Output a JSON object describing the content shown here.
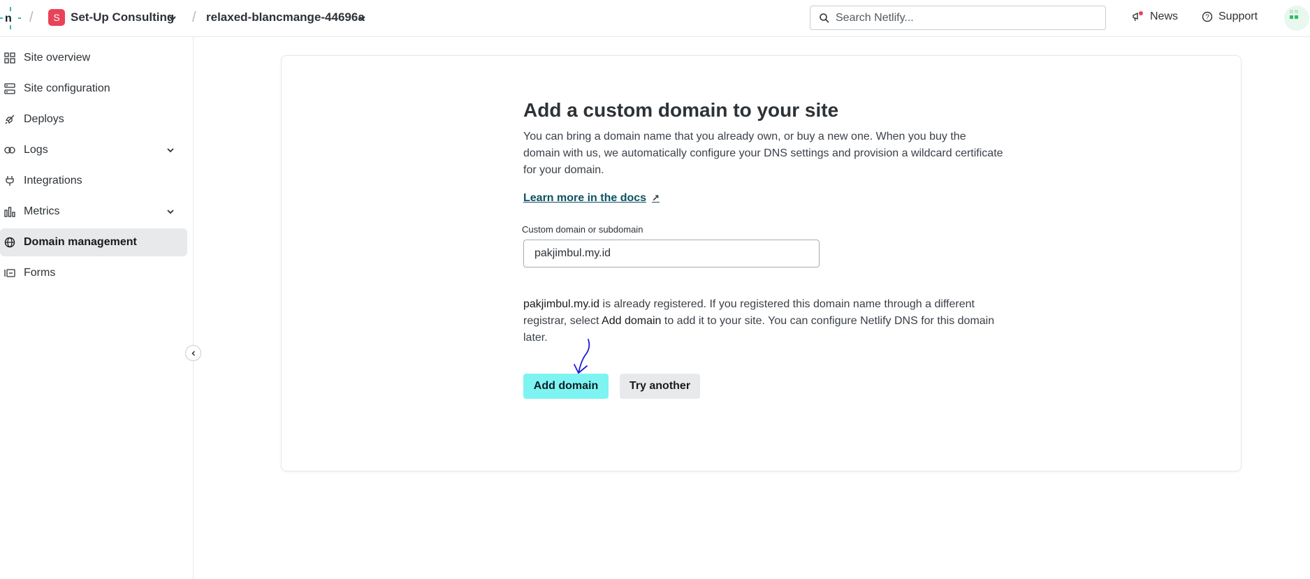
{
  "header": {
    "team_initial": "S",
    "team_name": "Set-Up Consulting",
    "site_name": "relaxed-blancmange-44696a",
    "search_placeholder": "Search Netlify...",
    "news_label": "News",
    "support_label": "Support",
    "separator": "/"
  },
  "sidebar": {
    "items": [
      {
        "label": "Site overview",
        "icon": "grid-icon"
      },
      {
        "label": "Site configuration",
        "icon": "settings-list-icon"
      },
      {
        "label": "Deploys",
        "icon": "rocket-icon"
      },
      {
        "label": "Logs",
        "icon": "logs-icon",
        "expandable": true
      },
      {
        "label": "Integrations",
        "icon": "plug-icon"
      },
      {
        "label": "Metrics",
        "icon": "bar-chart-icon",
        "expandable": true
      },
      {
        "label": "Domain management",
        "icon": "globe-icon",
        "active": true
      },
      {
        "label": "Forms",
        "icon": "form-icon"
      }
    ]
  },
  "main": {
    "heading": "Add a custom domain to your site",
    "description": "You can bring a domain name that you already own, or buy a new one. When you buy the domain with us, we automatically configure your DNS settings and provision a wildcard certificate for your domain.",
    "docs_link": "Learn more in the docs",
    "docs_arrow": "↗",
    "field_label": "Custom domain or subdomain",
    "field_value": "pakjimbul.my.id",
    "message_domain": "pakjimbul.my.id",
    "message_part1": " is already registered. If you registered this domain name through a different registrar, select ",
    "message_action": "Add domain",
    "message_part2": " to add it to your site. You can configure Netlify DNS for this domain later.",
    "add_button": "Add domain",
    "try_button": "Try another"
  },
  "colors": {
    "primary_button": "#7df4f2",
    "team_avatar": "#e9435a",
    "active_nav": "#e8e9eb",
    "link": "#0b5261",
    "annotation": "#1a1adb"
  }
}
